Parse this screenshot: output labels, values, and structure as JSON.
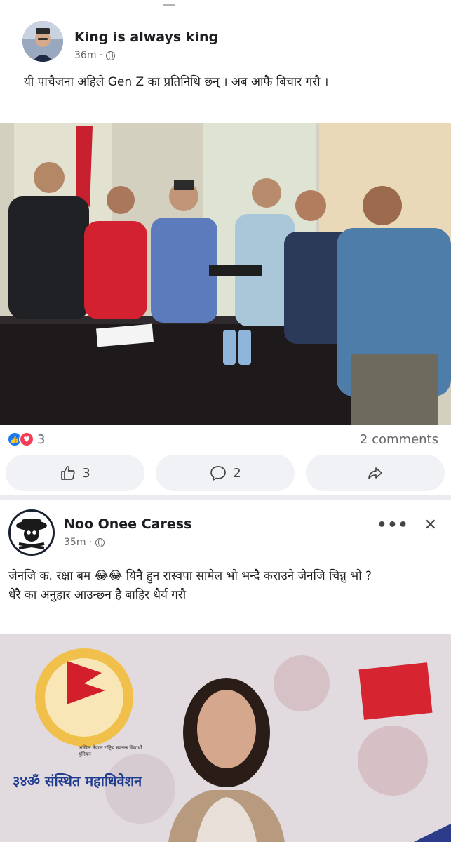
{
  "colors": {
    "accent": "#1877f2",
    "love": "#f33e58",
    "muted": "#65676b",
    "button_bg": "#f0f2f5"
  },
  "post1": {
    "author": "King is always king",
    "time": "36m ·",
    "text": "यी पाचैजना अहिले Gen Z का प्रतिनिधि छन् । अब आफै बिचार गरौ ।",
    "photo_icon": "group-photo",
    "reaction_count": "3",
    "comments_label": "2 comments",
    "like_count": "3",
    "comment_count": "2"
  },
  "post2": {
    "author": "Noo Onee Caress",
    "time": "35m ·",
    "text_line1": "जेनजि क. रक्षा बम 😂😂 यिनै हुन रास्वपा सामेल भो भन्दै कराउने जेनजि चिन्नु भो ?",
    "text_line2": "धेरै का अनुहार आउन्छन है बाहिर धैर्य गरौ",
    "more_icon": "•••",
    "close_icon": "✕",
    "banner_text": "३४ॐ संस्थित महाधिवेशन",
    "banner_sub": "अखिल नेपाल राष्ट्रिय स्वतन्त्र विद्यार्थी युनियन"
  }
}
